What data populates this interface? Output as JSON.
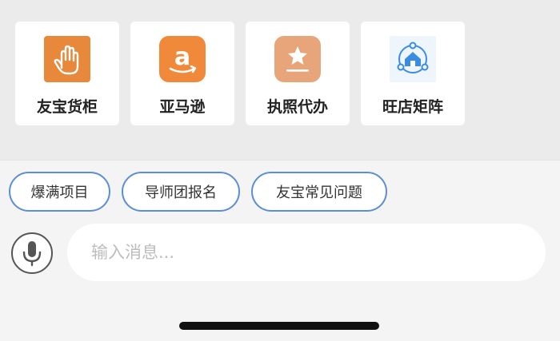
{
  "apps": [
    {
      "label": "友宝货柜",
      "icon": "hand-icon",
      "color": "#e8883a"
    },
    {
      "label": "亚马逊",
      "icon": "amazon-icon",
      "color": "#f08a3a"
    },
    {
      "label": "执照代办",
      "icon": "license-star-icon",
      "color": "#e8a57a"
    },
    {
      "label": "旺店矩阵",
      "icon": "store-network-icon",
      "color": "#3a8ce0"
    }
  ],
  "quick_replies": [
    "爆满项目",
    "导师团报名",
    "友宝常见问题"
  ],
  "input": {
    "placeholder": "输入消息..."
  },
  "mic": {
    "icon": "microphone-icon"
  }
}
